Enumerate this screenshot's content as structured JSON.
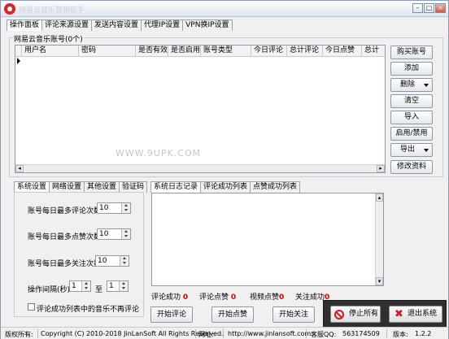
{
  "window": {
    "title": "网易云音乐营销助手",
    "min": "–",
    "max": "□",
    "close": "×"
  },
  "main_tabs": [
    "操作面板",
    "评论来源设置",
    "发送内容设置",
    "代理IP设置",
    "VPN换IP设置"
  ],
  "accounts": {
    "group_label": "网易云音乐账号(0个)",
    "columns": [
      "用户名",
      "密码",
      "是否有效",
      "是否启用",
      "账号类型",
      "今日评论",
      "总计评论",
      "今日点赞",
      "总计"
    ]
  },
  "watermark": "WWW.9UPK.COM",
  "side_buttons": [
    {
      "label": "购买账号"
    },
    {
      "label": "添加"
    },
    {
      "label": "删除"
    },
    {
      "label": "清空"
    },
    {
      "label": "导入"
    },
    {
      "label": "启用/禁用"
    },
    {
      "label": "导出"
    },
    {
      "label": "修改资料"
    }
  ],
  "settings_tabs": [
    "系统设置",
    "网络设置",
    "其他设置",
    "验证码"
  ],
  "settings": {
    "daily_comments_label": "账号每日最多评论次数",
    "daily_comments_value": "10",
    "daily_likes_label": "账号每日最多点赞次数",
    "daily_likes_value": "10",
    "daily_follows_label": "账号每日最多关注次数",
    "daily_follows_value": "10",
    "interval_label": "操作间隔(秒)",
    "interval_from": "1",
    "interval_to_label": "至",
    "interval_to": "1",
    "skip_commented_label": "评论成功列表中的音乐不再评论"
  },
  "log_tabs": [
    "系统日志记录",
    "评论成功列表",
    "点赞成功列表"
  ],
  "stats": {
    "comment_success_label": "评论成功",
    "comment_success": "0",
    "comment_likes_label": "评论点赞",
    "comment_likes": "0",
    "video_likes_label": "视频点赞",
    "video_likes": "0",
    "follow_success_label": "关注成功",
    "follow_success": "0"
  },
  "actions": {
    "start_comment": "开始评论",
    "start_like": "开始点赞",
    "start_follow": "开始关注",
    "stop": "停止所有",
    "exit": "退出系统"
  },
  "statusbar": {
    "copyright_label": "版权所有:",
    "copyright": "Copyright (C) 2010-2018 JinLanSoft All Rights Reserved.",
    "website_label": "网址:",
    "website": "http://www.jinlansoft.com",
    "qq_label": "客服QQ:",
    "qq": "563174509",
    "version_label": "版本:",
    "version": "1.2.2"
  }
}
